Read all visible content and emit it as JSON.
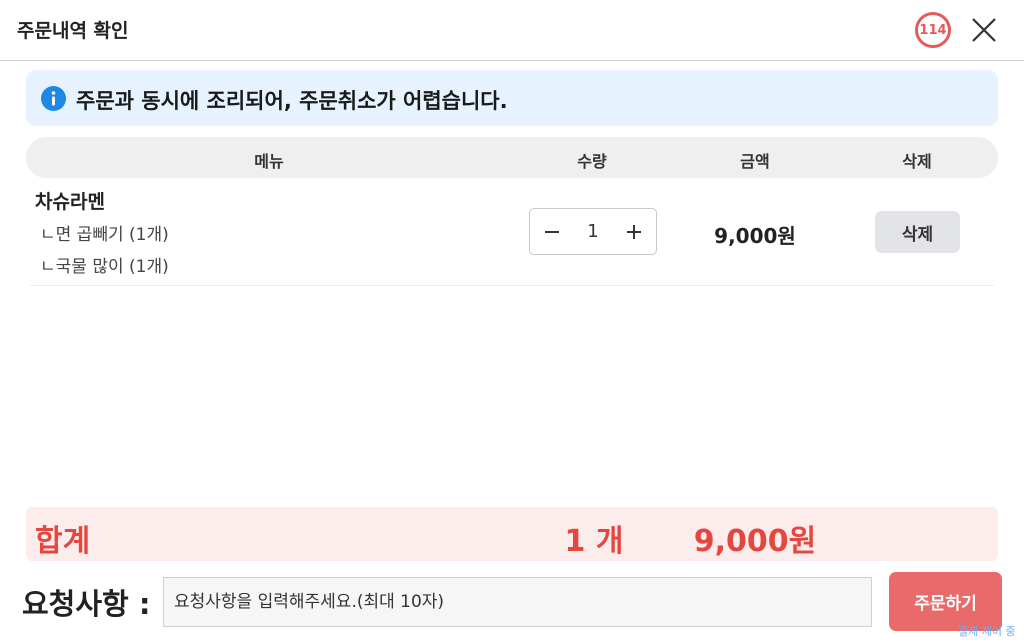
{
  "header": {
    "title": "주문내역 확인",
    "timer": "114"
  },
  "notice": {
    "text": "주문과 동시에 조리되어, 주문취소가 어렵습니다."
  },
  "table": {
    "columns": {
      "menu": "메뉴",
      "quantity": "수량",
      "amount": "금액",
      "delete": "삭제"
    },
    "rows": [
      {
        "name": "차슈라멘",
        "options": [
          "ㄴ면 곱빼기 (1개)",
          "ㄴ국물 많이 (1개)"
        ],
        "quantity": "1",
        "price": "9,000원",
        "delete_label": "삭제"
      }
    ]
  },
  "total": {
    "label": "합계",
    "count": "1 개",
    "price": "9,000원"
  },
  "request": {
    "label": "요청사항 :",
    "placeholder": "요청사항을 입력해주세요.(최대 10자)"
  },
  "order_button": "주문하기",
  "status_text": "결제 제어 중",
  "colors": {
    "accent": "#e4473f",
    "button": "#e86a6a",
    "notice_bg": "#e6f2fd",
    "info": "#1e88e5"
  },
  "icons": {
    "info": "info-icon",
    "close": "close-icon",
    "minus": "minus-icon",
    "plus": "plus-icon"
  }
}
